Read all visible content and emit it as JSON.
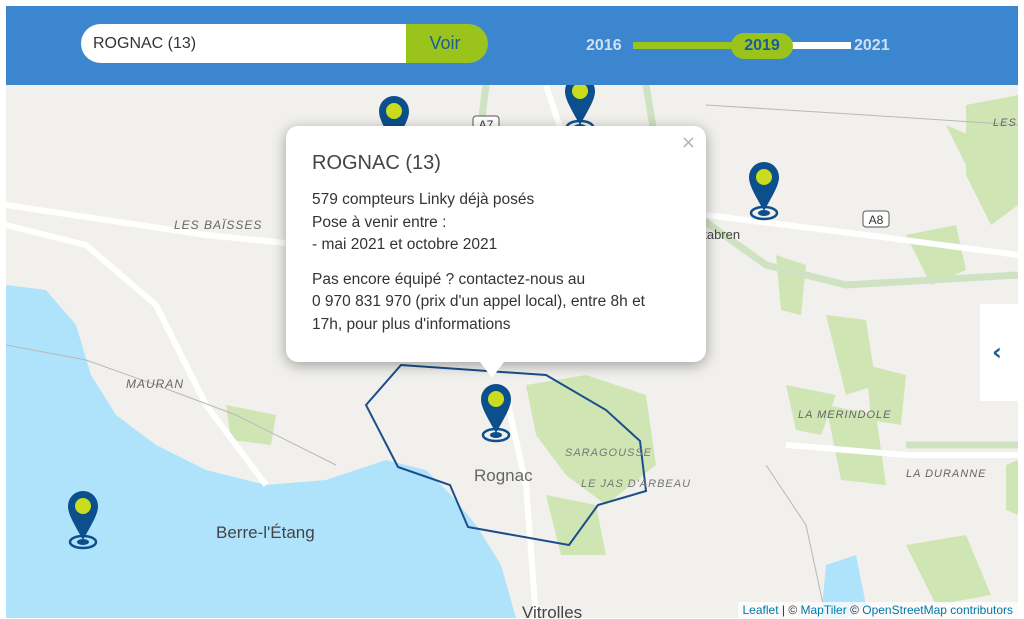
{
  "search": {
    "value": "ROGNAC (13)",
    "button_label": "Voir"
  },
  "timeline": {
    "start_year": "2016",
    "selected_year": "2019",
    "end_year": "2021"
  },
  "popup": {
    "title": "ROGNAC (13)",
    "line1": "579 compteurs Linky déjà posés",
    "line2": "Pose à venir entre :",
    "line3": "- mai 2021 et octobre 2021",
    "contact_line1": "Pas encore équipé ? contactez-nous au",
    "contact_line2": "0 970 831 970 (prix d'un appel local), entre 8h et",
    "contact_line3": "17h, pour plus d'informations",
    "close_symbol": "×"
  },
  "map": {
    "labels": {
      "rognac": "Rognac",
      "berre": "Berre-l'Étang",
      "vitrolles": "Vitrolles",
      "cabries": "Cabries",
      "les_baisses": "LES BAÏSSES",
      "mauran": "MAURAN",
      "saragousse": "SARAGOUSSE",
      "jas_darbeau": "LE JAS D'ARBEAU",
      "la_merindole": "LA MERINDOLE",
      "la_duranne": "LA DURANNE",
      "les": "LES",
      "tabren": "ntabren"
    },
    "roads": {
      "a7": "A7",
      "a8": "A8"
    },
    "side_tab_icon": "chevron-left-icon",
    "side_tab_glyph": "‹"
  },
  "attribution": {
    "leaflet": "Leaflet",
    "separator": " | © ",
    "maptiler": "MapTiler",
    "separator2": " © ",
    "osm": "OpenStreetMap contributors"
  },
  "colors": {
    "header": "#3c86cf",
    "accent_green": "#9ac31c",
    "marker_blue": "#0d4f8c",
    "marker_dot": "#c9dd1e",
    "water": "#aee3fb",
    "boundary": "#1a4f8c"
  }
}
